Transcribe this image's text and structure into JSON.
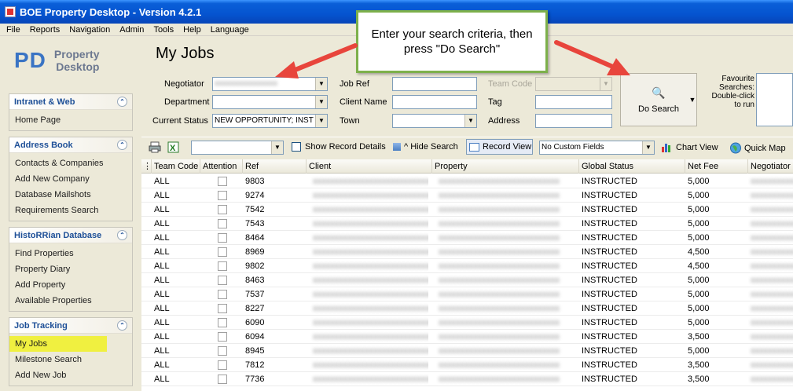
{
  "window": {
    "title": "BOE Property Desktop - Version 4.2.1"
  },
  "menu": [
    "File",
    "Reports",
    "Navigation",
    "Admin",
    "Tools",
    "Help",
    "Language"
  ],
  "logo": {
    "mark": "PD",
    "line1": "Property",
    "line2": "Desktop"
  },
  "sidebar": {
    "groups": [
      {
        "title": "Intranet & Web",
        "items": [
          "Home Page"
        ]
      },
      {
        "title": "Address Book",
        "items": [
          "Contacts & Companies",
          "Add New Company",
          "Database Mailshots",
          "Requirements Search"
        ]
      },
      {
        "title": "HistoRRian Database",
        "items": [
          "Find Properties",
          "Property Diary",
          "Add Property",
          "Available Properties"
        ]
      },
      {
        "title": "Job Tracking",
        "items": [
          "My Jobs",
          "Milestone Search",
          "Add New Job"
        ]
      }
    ]
  },
  "page": {
    "title": "My Jobs"
  },
  "search": {
    "negotiator_label": "Negotiator",
    "department_label": "Department",
    "current_status_label": "Current Status",
    "current_status_value": "NEW OPPORTUNITY; INST",
    "job_ref_label": "Job Ref",
    "client_name_label": "Client Name",
    "town_label": "Town",
    "team_code_label": "Team Code",
    "tag_label": "Tag",
    "address_label": "Address",
    "do_search_label": "Do Search",
    "favourites_label": "Favourite Searches: Double-click to run"
  },
  "callout": {
    "text": "Enter your search criteria, then press \"Do Search\""
  },
  "toolbar": {
    "show_record_details": "Show Record Details",
    "hide_search": "^ Hide Search",
    "record_view": "Record View",
    "custom_fields": "No Custom Fields",
    "chart_view": "Chart View",
    "quick_map": "Quick Map"
  },
  "grid": {
    "columns": [
      "Team Code",
      "Attention",
      "Ref",
      "Client",
      "Property",
      "Global Status",
      "Net Fee",
      "Negotiator"
    ],
    "rows": [
      {
        "team": "ALL",
        "ref": "9803",
        "status": "INSTRUCTED",
        "fee": "5,000"
      },
      {
        "team": "ALL",
        "ref": "9274",
        "status": "INSTRUCTED",
        "fee": "5,000"
      },
      {
        "team": "ALL",
        "ref": "7542",
        "status": "INSTRUCTED",
        "fee": "5,000"
      },
      {
        "team": "ALL",
        "ref": "7543",
        "status": "INSTRUCTED",
        "fee": "5,000"
      },
      {
        "team": "ALL",
        "ref": "8464",
        "status": "INSTRUCTED",
        "fee": "5,000"
      },
      {
        "team": "ALL",
        "ref": "8969",
        "status": "INSTRUCTED",
        "fee": "4,500"
      },
      {
        "team": "ALL",
        "ref": "9802",
        "status": "INSTRUCTED",
        "fee": "4,500"
      },
      {
        "team": "ALL",
        "ref": "8463",
        "status": "INSTRUCTED",
        "fee": "5,000"
      },
      {
        "team": "ALL",
        "ref": "7537",
        "status": "INSTRUCTED",
        "fee": "5,000"
      },
      {
        "team": "ALL",
        "ref": "8227",
        "status": "INSTRUCTED",
        "fee": "5,000"
      },
      {
        "team": "ALL",
        "ref": "6090",
        "status": "INSTRUCTED",
        "fee": "5,000"
      },
      {
        "team": "ALL",
        "ref": "6094",
        "status": "INSTRUCTED",
        "fee": "3,500"
      },
      {
        "team": "ALL",
        "ref": "8945",
        "status": "INSTRUCTED",
        "fee": "5,000"
      },
      {
        "team": "ALL",
        "ref": "7812",
        "status": "INSTRUCTED",
        "fee": "3,500"
      },
      {
        "team": "ALL",
        "ref": "7736",
        "status": "INSTRUCTED",
        "fee": "3,500"
      }
    ]
  }
}
